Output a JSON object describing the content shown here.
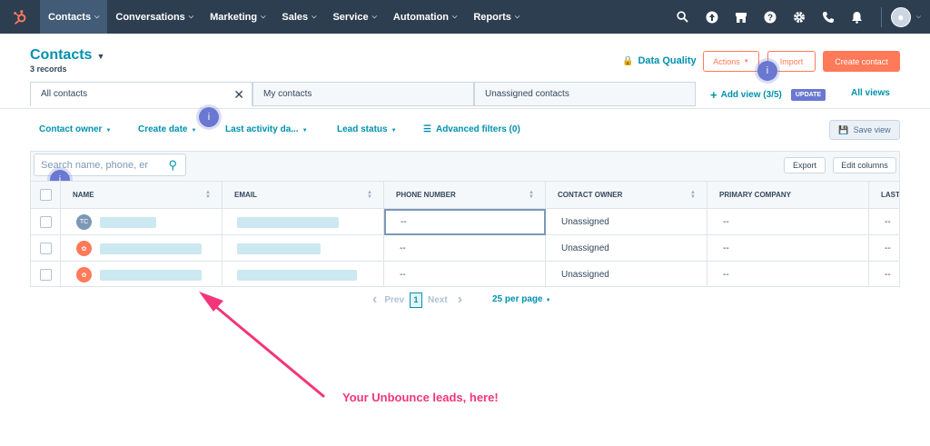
{
  "nav": {
    "items": [
      "Contacts",
      "Conversations",
      "Marketing",
      "Sales",
      "Service",
      "Automation",
      "Reports"
    ]
  },
  "page": {
    "title": "Contacts",
    "records": "3 records"
  },
  "header": {
    "data_quality": "Data Quality",
    "actions": "Actions",
    "import": "Import",
    "create": "Create contact"
  },
  "tabs": [
    "All contacts",
    "My contacts",
    "Unassigned contacts"
  ],
  "views": {
    "add": "Add view (3/5)",
    "update": "UPDATE",
    "all": "All views"
  },
  "filters": [
    "Contact owner",
    "Create date",
    "Last activity da...",
    "Lead status",
    "Advanced filters (0)"
  ],
  "save_view": "Save view",
  "search": {
    "placeholder": "Search name, phone, er"
  },
  "table_actions": {
    "export": "Export",
    "edit_columns": "Edit columns"
  },
  "columns": [
    "NAME",
    "EMAIL",
    "PHONE NUMBER",
    "CONTACT OWNER",
    "PRIMARY COMPANY",
    "LAST"
  ],
  "rows": [
    {
      "avatar": "TC",
      "phone": "--",
      "owner": "Unassigned",
      "company": "--",
      "last": "--"
    },
    {
      "avatar": "",
      "phone": "--",
      "owner": "Unassigned",
      "company": "--",
      "last": "--"
    },
    {
      "avatar": "",
      "phone": "--",
      "owner": "Unassigned",
      "company": "--",
      "last": "--"
    }
  ],
  "pagination": {
    "prev": "Prev",
    "page": "1",
    "next": "Next",
    "per_page": "25 per page"
  },
  "annotation": "Your Unbounce leads, here!",
  "badge": "i",
  "colors": {
    "nav_bg": "#2d3e50",
    "accent": "#0091ae",
    "orange": "#ff7a59",
    "annotation": "#f2357a",
    "badge": "#6a78d1"
  }
}
